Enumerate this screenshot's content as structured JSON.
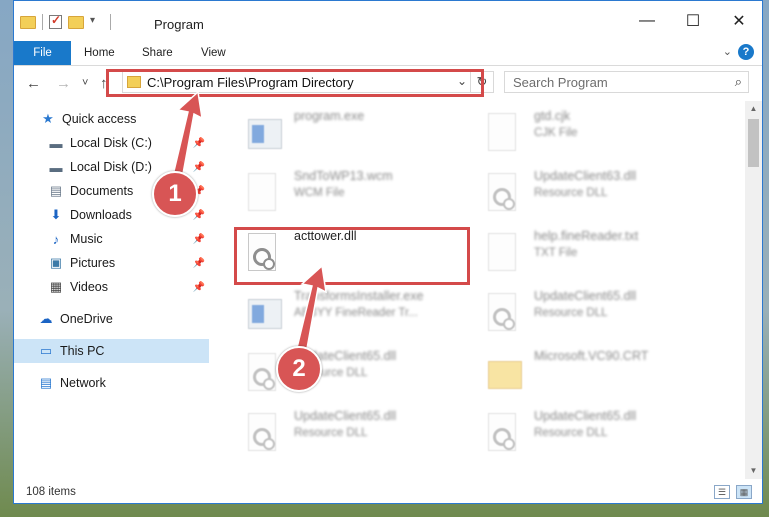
{
  "window": {
    "title": "Program",
    "buttons": {
      "minimize": "—",
      "maximize": "☐",
      "close": "✕"
    }
  },
  "ribbon": {
    "tabs": [
      "File",
      "Home",
      "Share",
      "View"
    ],
    "help": "?",
    "expand": "⌄"
  },
  "nav": {
    "back": "←",
    "forward": "→",
    "recent": "˅",
    "up": "↑",
    "address": "C:\\Program Files\\Program Directory",
    "address_dropdown": "⌄",
    "refresh": "↻",
    "search_placeholder": "Search Program",
    "search_icon": "⌕"
  },
  "sidebar": {
    "items": [
      {
        "label": "Quick access",
        "icon": "star-icon",
        "glyph": "★",
        "color": "#2b79d0"
      },
      {
        "label": "Local Disk (C:)",
        "icon": "drive-icon",
        "glyph": "▬",
        "color": "#5a6d80",
        "pinned": "📌"
      },
      {
        "label": "Local Disk (D:)",
        "icon": "drive-icon",
        "glyph": "▬",
        "color": "#5a6d80",
        "pinned": "📌"
      },
      {
        "label": "Documents",
        "icon": "document-icon",
        "glyph": "▤",
        "color": "#6b7a8b",
        "pinned": "📌"
      },
      {
        "label": "Downloads",
        "icon": "download-icon",
        "glyph": "⬇",
        "color": "#1b64c4",
        "pinned": "📌"
      },
      {
        "label": "Music",
        "icon": "music-icon",
        "glyph": "♪",
        "color": "#1b64c4",
        "pinned": "📌"
      },
      {
        "label": "Pictures",
        "icon": "picture-icon",
        "glyph": "▣",
        "color": "#3c7aa8",
        "pinned": "📌"
      },
      {
        "label": "Videos",
        "icon": "video-icon",
        "glyph": "▦",
        "color": "#444444",
        "pinned": "📌"
      },
      {
        "label": "OneDrive",
        "icon": "cloud-icon",
        "glyph": "☁",
        "color": "#1b64c4"
      },
      {
        "label": "This PC",
        "icon": "computer-icon",
        "glyph": "▭",
        "color": "#2b79d0"
      },
      {
        "label": "Network",
        "icon": "network-icon",
        "glyph": "▤",
        "color": "#2b79d0"
      }
    ]
  },
  "files": [
    {
      "name": "program.exe",
      "type": "",
      "icon": "exe-icon",
      "col": 0,
      "row": 0
    },
    {
      "name": "gtd.cjk",
      "type": "CJK File",
      "icon": "file-icon",
      "col": 1,
      "row": 0
    },
    {
      "name": "SndToWP13.wcm",
      "type": "WCM File",
      "icon": "file-icon",
      "col": 0,
      "row": 1
    },
    {
      "name": "UpdateClient63.dll",
      "type": "Resource DLL",
      "icon": "dll-icon",
      "col": 1,
      "row": 1
    },
    {
      "name": "acttower.dll",
      "type": "",
      "icon": "dll-icon",
      "col": 0,
      "row": 2,
      "clear": true
    },
    {
      "name": "help.fineReader.txt",
      "type": "TXT File",
      "icon": "file-icon",
      "col": 1,
      "row": 2
    },
    {
      "name": "TransformsInstaller.exe",
      "type": "ABBYY FineReader Tr...",
      "icon": "exe-icon",
      "col": 0,
      "row": 3
    },
    {
      "name": "UpdateClient65.dll",
      "type": "Resource DLL",
      "icon": "dll-icon",
      "col": 1,
      "row": 3
    },
    {
      "name": "UpdateClient65.dll",
      "type": "Resource DLL",
      "icon": "dll-icon",
      "col": 0,
      "row": 4
    },
    {
      "name": "Microsoft.VC90.CRT",
      "type": "",
      "icon": "folder-icon",
      "col": 1,
      "row": 4
    },
    {
      "name": "UpdateClient65.dll",
      "type": "Resource DLL",
      "icon": "dll-icon",
      "col": 0,
      "row": 5
    },
    {
      "name": "UpdateClient65.dll",
      "type": "Resource DLL",
      "icon": "dll-icon",
      "col": 1,
      "row": 5
    }
  ],
  "status": {
    "count": "108 items"
  },
  "callouts": [
    "1",
    "2"
  ],
  "colors": {
    "accent": "#1979ca",
    "highlight": "#d44a4a",
    "selected": "#cce4f7"
  }
}
